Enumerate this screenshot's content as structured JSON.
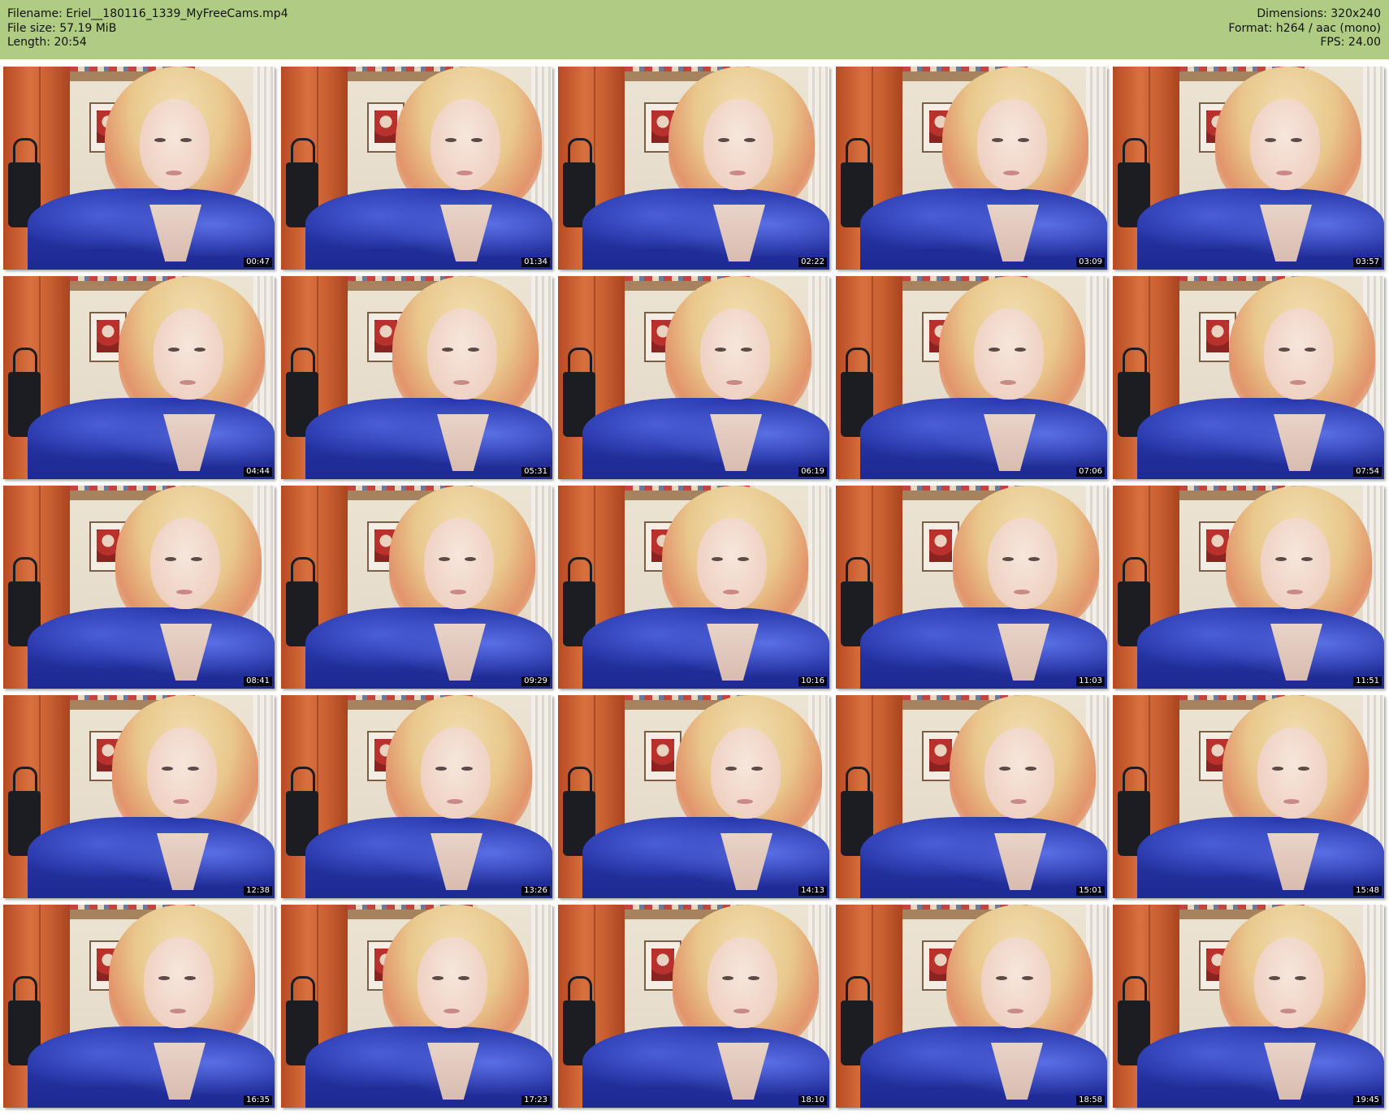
{
  "header": {
    "filename_line": "Filename: Eriel__180116_1339_MyFreeCams.mp4",
    "filesize_line": "File size: 57.19 MiB",
    "length_line": "Length: 20:54",
    "dimensions_line": "Dimensions: 320x240",
    "format_line": "Format: h264 / aac (mono)",
    "fps_line": "FPS: 24.00"
  },
  "colors": {
    "header_bg": "#b0cb82",
    "page_bg": "#ffffff"
  },
  "thumbnails": [
    {
      "timestamp": "00:47"
    },
    {
      "timestamp": "01:34"
    },
    {
      "timestamp": "02:22"
    },
    {
      "timestamp": "03:09"
    },
    {
      "timestamp": "03:57"
    },
    {
      "timestamp": "04:44"
    },
    {
      "timestamp": "05:31"
    },
    {
      "timestamp": "06:19"
    },
    {
      "timestamp": "07:06"
    },
    {
      "timestamp": "07:54"
    },
    {
      "timestamp": "08:41"
    },
    {
      "timestamp": "09:29"
    },
    {
      "timestamp": "10:16"
    },
    {
      "timestamp": "11:03"
    },
    {
      "timestamp": "11:51"
    },
    {
      "timestamp": "12:38"
    },
    {
      "timestamp": "13:26"
    },
    {
      "timestamp": "14:13"
    },
    {
      "timestamp": "15:01"
    },
    {
      "timestamp": "15:48"
    },
    {
      "timestamp": "16:35"
    },
    {
      "timestamp": "17:23"
    },
    {
      "timestamp": "18:10"
    },
    {
      "timestamp": "18:58"
    },
    {
      "timestamp": "19:45"
    }
  ]
}
